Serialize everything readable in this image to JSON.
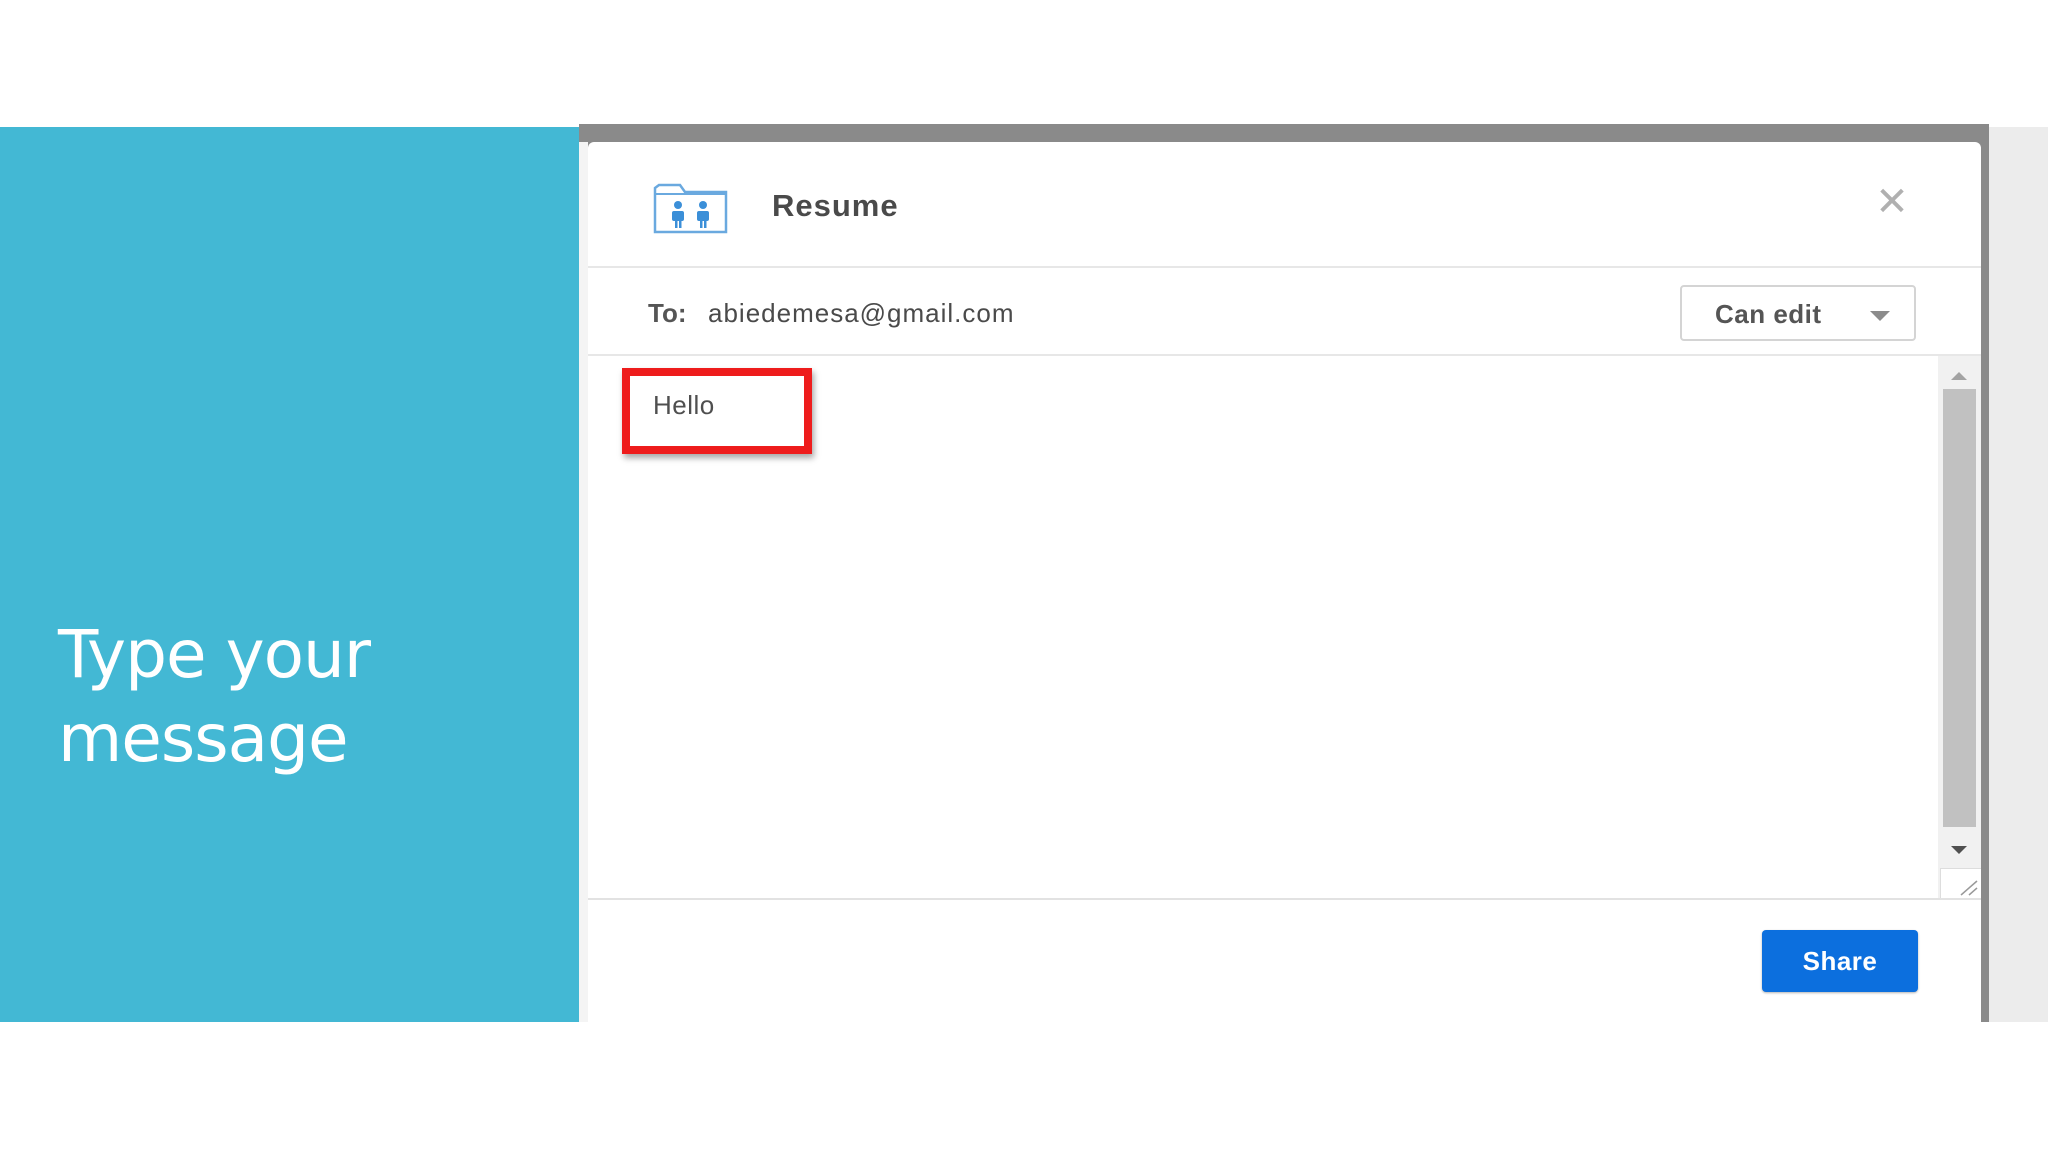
{
  "slide": {
    "title_line1": "Type your",
    "title_line2": "message"
  },
  "dialog": {
    "title": "Resume",
    "folder_icon": "shared-folder-icon",
    "close_icon": "close-icon",
    "to_label": "To:",
    "to_email": "abiedemesa@gmail.com",
    "permission": "Can edit",
    "message": "Hello",
    "share_label": "Share"
  },
  "colors": {
    "teal_panel": "#43b8d4",
    "share_button": "#0c6fde",
    "highlight": "#ee1c1c"
  }
}
